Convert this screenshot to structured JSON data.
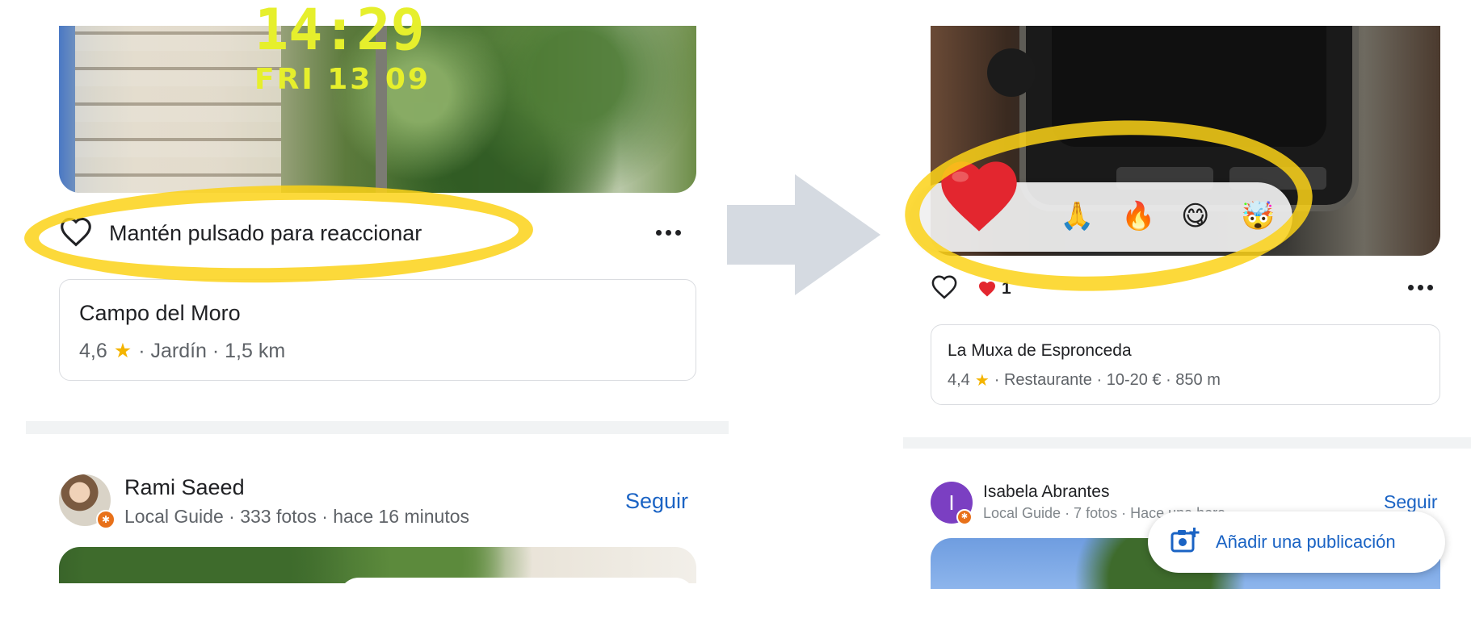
{
  "left": {
    "reaction_prompt": "Mantén pulsado para reaccionar",
    "place_card": {
      "name": "Campo del Moro",
      "rating": "4,6",
      "details": "· Jardín · 1,5 km"
    },
    "post": {
      "author": "Rami Saeed",
      "meta": "Local Guide · 333 fotos · hace 16 minutos",
      "follow_label": "Seguir"
    }
  },
  "right": {
    "photo": {
      "time": "14:29",
      "date": "FRI  13 09"
    },
    "reactions": [
      "❤️",
      "🙏",
      "🔥",
      "😋",
      "🤯"
    ],
    "reaction_count": "1",
    "place_card": {
      "name": "La Muxa de Espronceda",
      "rating": "4,4",
      "details": "· Restaurante · 10-20 € · 850 m"
    },
    "post": {
      "author": "Isabela Abrantes",
      "avatar_initial": "I",
      "meta": "Local Guide · 7 fotos · Hace una hora",
      "follow_label": "Seguir"
    },
    "fab_label": "Añadir una publicación"
  },
  "icons": {
    "heart_outline": "heart-outline-icon",
    "more": "more-horizontal-icon",
    "star": "star-icon",
    "arrow": "arrow-right-icon",
    "add_photo": "add-photo-icon",
    "local_guide_badge": "local-guide-badge-icon"
  },
  "colors": {
    "link": "#1a63c4",
    "star": "#f4b400",
    "annotation": "#fcd218",
    "badge": "#e8711a",
    "avatar_right": "#7b3fc2"
  }
}
